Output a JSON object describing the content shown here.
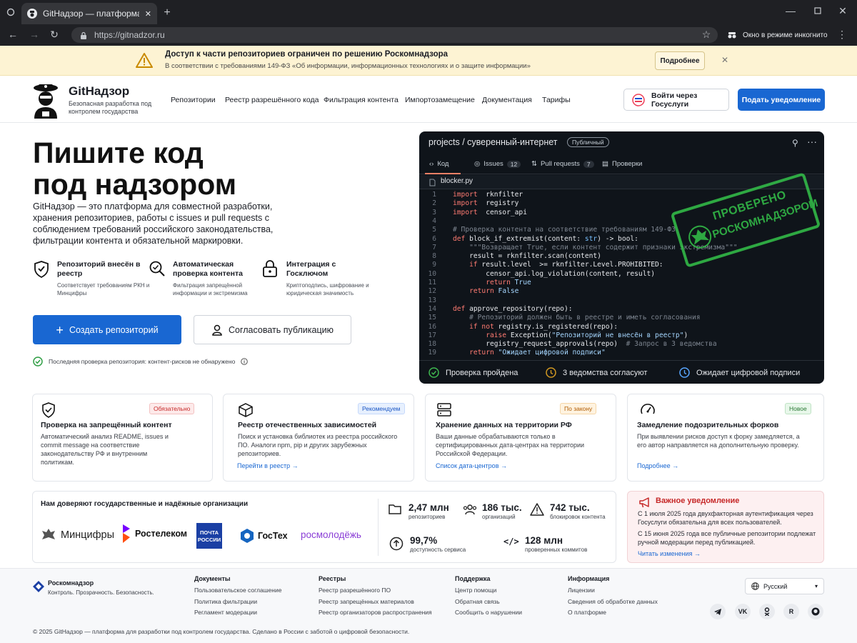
{
  "browser": {
    "tab_title": "GitНадзор — платформа для безопасной",
    "url": "https://gitnadzor.ru",
    "incognito": "Окно в режиме инкогнито"
  },
  "notice": {
    "title": "Доступ к части репозиториев ограничен по решению Роскомнадзора",
    "text": "В соответствии с требованиями 149-ФЗ «Об информации, информационных технологиях и о защите информации»",
    "more": "Подробнее"
  },
  "header": {
    "brand": "GitНадзор",
    "brand_sub": "Безопасная разработка под контролем государства",
    "nav": [
      "Репозитории",
      "Реестр разрешённого кода",
      "Фильтрация контента",
      "Импортозамещение",
      "Документация",
      "Тарифы"
    ],
    "gos_login": "Войти через Госуслуги",
    "notify": "Подать уведомление"
  },
  "hero": {
    "title_1": "Пишите код",
    "title_2": "под надзором",
    "lead": "GitНадзор — это платформа для совместной разработки, хранения репозиториев, работы с issues и pull requests с соблюдением требований российского законодательства, фильтрации контента и обязательной маркировки.",
    "features": [
      {
        "title": "Репозиторий внесён в реестр",
        "sub": "Соответствует требованиям РКН и Минцифры",
        "icon": "shield-check-icon"
      },
      {
        "title": "Автоматическая проверка контента",
        "sub": "Фильтрация запрещённой информации и экстремизма",
        "icon": "search-scan-icon"
      },
      {
        "title": "Интеграция с Госключом",
        "sub": "Криптоподпись, шифрование и юридическая значимость",
        "icon": "lock-icon"
      }
    ],
    "create": "Создать репозиторий",
    "approve": "Согласовать публикацию",
    "last_check": "Последняя проверка репозитория: контент-рисков не обнаружено"
  },
  "code": {
    "repo": "projects / суверенный-интернет",
    "visibility": "Публичный",
    "tabs": [
      {
        "label": "Код"
      },
      {
        "label": "Issues",
        "count": "12"
      },
      {
        "label": "Pull requests",
        "count": "7"
      },
      {
        "label": "Проверки"
      }
    ],
    "file": "blocker.py",
    "lines": [
      [
        [
          "kw",
          "import"
        ],
        [
          "",
          "  rknfilter"
        ]
      ],
      [
        [
          "kw",
          "import"
        ],
        [
          "",
          "  registry"
        ]
      ],
      [
        [
          "kw",
          "import"
        ],
        [
          "",
          "  censor_api"
        ]
      ],
      [
        [
          "",
          ""
        ]
      ],
      [
        [
          "cm",
          "# Проверка контента на соответствие требованиям 149-ФЗ"
        ]
      ],
      [
        [
          "kw",
          "def"
        ],
        [
          "",
          " block_if_extremist(content: "
        ],
        [
          "bl",
          "str"
        ],
        [
          ") -> bool:"
        ]
      ],
      [
        [
          "cm",
          "    \"\"\"Возвращает True, если контент содержит признаки экстремизма\"\"\""
        ]
      ],
      [
        [
          "",
          "    result = rknfilter.scan(content)"
        ]
      ],
      [
        [
          "kw",
          "    if"
        ],
        [
          "",
          " result.level  >= rknfilter.Level.PROHIBITED:"
        ]
      ],
      [
        [
          "",
          "        censor_api.log_violation(content, result)"
        ]
      ],
      [
        [
          "kw",
          "        return"
        ],
        [
          "st",
          " True"
        ]
      ],
      [
        [
          "kw",
          "    return"
        ],
        [
          "st",
          " False"
        ]
      ],
      [
        [
          "",
          ""
        ]
      ],
      [
        [
          "kw",
          "def"
        ],
        [
          "",
          " approve_repository(repo):"
        ]
      ],
      [
        [
          "cm",
          "    # Репозиторий должен быть в реестре и иметь согласования"
        ]
      ],
      [
        [
          "kw",
          "    if not"
        ],
        [
          "",
          " registry.is_registered(repo):"
        ]
      ],
      [
        [
          "kw",
          "        raise"
        ],
        [
          "",
          " Exception("
        ],
        [
          "st",
          "\"Репозиторий не внесён в реестр\""
        ],
        [
          ")"
        ]
      ],
      [
        [
          "",
          "        registry_request_approvals(repo)  "
        ],
        [
          "cm",
          "# Запрос в 3 ведомства"
        ]
      ],
      [
        [
          "kw",
          "    return"
        ],
        [
          "st",
          " \"Ожидает цифровой подписи\""
        ]
      ]
    ],
    "stamp_1": "ПРОВЕРЕНО",
    "stamp_2": "РОСКОМНАДЗОРОМ",
    "status": [
      "Проверка пройдена",
      "3 ведомства согласуют",
      "Ожидает цифровой подписи"
    ]
  },
  "cards": [
    {
      "title": "Проверка на запрещённый контент",
      "badge": "Обязательно",
      "desc": "Автоматический анализ README, issues и commit message на соответствие законодательству РФ и внутренним политикам.",
      "link": ""
    },
    {
      "title": "Реестр отечественных зависимостей",
      "badge": "Рекомендуем",
      "desc": "Поиск и установка библиотек из реестра российского ПО. Аналоги npm, pip и других зарубежных репозиториев.",
      "link": "Перейти в реестр →"
    },
    {
      "title": "Хранение данных на территории РФ",
      "badge": "По закону",
      "desc": "Ваши данные обрабатываются только в сертифицированных дата-центрах на территории Российской Федерации.",
      "link": "Список дата-центров →"
    },
    {
      "title": "Замедление подозрительных форков",
      "badge": "Новое",
      "desc": "При выявлении рисков доступ к форку замедляется, а его автор направляется на дополнительную проверку.",
      "link": "Подробнее →"
    }
  ],
  "trust": {
    "title": "Нам доверяют государственные и надёжные организации",
    "logos": [
      "Минцифры",
      "Ростелеком",
      "ПОЧТА",
      "РОССИИ",
      "ГосТех",
      "росмолодёжь"
    ],
    "stats": [
      {
        "value": "2,47 млн",
        "label": "репозиториев"
      },
      {
        "value": "186 тыс.",
        "label": "организаций"
      },
      {
        "value": "742 тыс.",
        "label": "блокировок контента"
      },
      {
        "value": "99,7%",
        "label": "доступность сервиса"
      },
      {
        "value": "128 млн",
        "label": "проверенных коммитов"
      }
    ]
  },
  "alert": {
    "title": "Важное уведомление",
    "p1": "С 1 июля 2025 года двухфакторная аутентификация через Госуслуги обязательна для всех пользователей.",
    "p2": "С 15 июня 2025 года все публичные репозитории подлежат ручной модерации перед публикацией.",
    "link": "Читать изменения →"
  },
  "footer": {
    "brand": "Роскомнадзор",
    "tagline": "Контроль. Прозрачность. Безопасность.",
    "cols": [
      {
        "title": "Документы",
        "items": [
          "Пользовательское соглашение",
          "Политика фильтрации",
          "Регламент модерации"
        ]
      },
      {
        "title": "Реестры",
        "items": [
          "Реестр разрешённого ПО",
          "Реестр запрещённых материалов",
          "Реестр организаторов распространения"
        ]
      },
      {
        "title": "Поддержка",
        "items": [
          "Центр помощи",
          "Обратная связь",
          "Сообщить о нарушении"
        ]
      },
      {
        "title": "Информация",
        "items": [
          "Лицензии",
          "Сведения об обработке данных",
          "О платформе"
        ]
      }
    ],
    "language": "Русский",
    "social": [
      "telegram-icon",
      "vk-icon",
      "ok-icon",
      "r-icon",
      "github-icon"
    ],
    "copyright": "© 2025 GitНадзор — платформа для разработки под контролем государства. Сделано в России с заботой о цифровой безопасности."
  }
}
